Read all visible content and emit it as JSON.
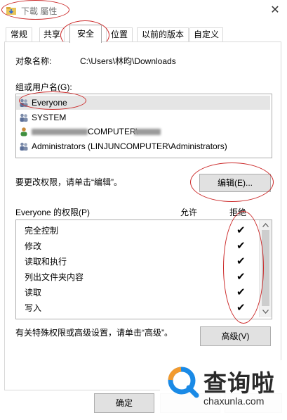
{
  "window": {
    "title": "下載 屬性",
    "close_glyph": "✕"
  },
  "tabs": [
    {
      "label": "常规"
    },
    {
      "label": "共享"
    },
    {
      "label": "安全",
      "active": true
    },
    {
      "label": "位置"
    },
    {
      "label": "以前的版本"
    },
    {
      "label": "自定义"
    }
  ],
  "object": {
    "label": "对象名称:",
    "value": "C:\\Users\\林昀\\Downloads"
  },
  "groups": {
    "label": "组或用户名(G):",
    "items": [
      {
        "label": "Everyone",
        "icon": "group-icon",
        "selected": true
      },
      {
        "label": "SYSTEM",
        "icon": "group-icon"
      },
      {
        "label": "COMPUTER\\",
        "icon": "user-icon",
        "blurred": true
      },
      {
        "label": "Administrators (LINJUNCOMPUTER\\Administrators)",
        "icon": "group-icon"
      }
    ]
  },
  "edit_hint": "要更改权限，请单击“编辑”。",
  "edit_button": "编辑(E)...",
  "permissions": {
    "label": "Everyone 的权限(P)",
    "allow_header": "允许",
    "deny_header": "拒绝",
    "rows": [
      {
        "label": "完全控制",
        "deny": true
      },
      {
        "label": "修改",
        "deny": true
      },
      {
        "label": "读取和执行",
        "deny": true
      },
      {
        "label": "列出文件夹内容",
        "deny": true
      },
      {
        "label": "读取",
        "deny": true
      },
      {
        "label": "写入",
        "deny": true
      }
    ],
    "check_glyph": "✔"
  },
  "advanced_hint": "有关特殊权限或高级设置，请单击“高级”。",
  "advanced_button": "高级(V)",
  "footer": {
    "ok_button": "确定"
  },
  "watermark": {
    "text": "查询啦",
    "url": "chaxunla.com"
  },
  "colors": {
    "annotation": "#cc2b2b",
    "selection": "#e5e5e5",
    "button": "#e1e1e1",
    "watermark_blue": "#1a8ae6"
  }
}
